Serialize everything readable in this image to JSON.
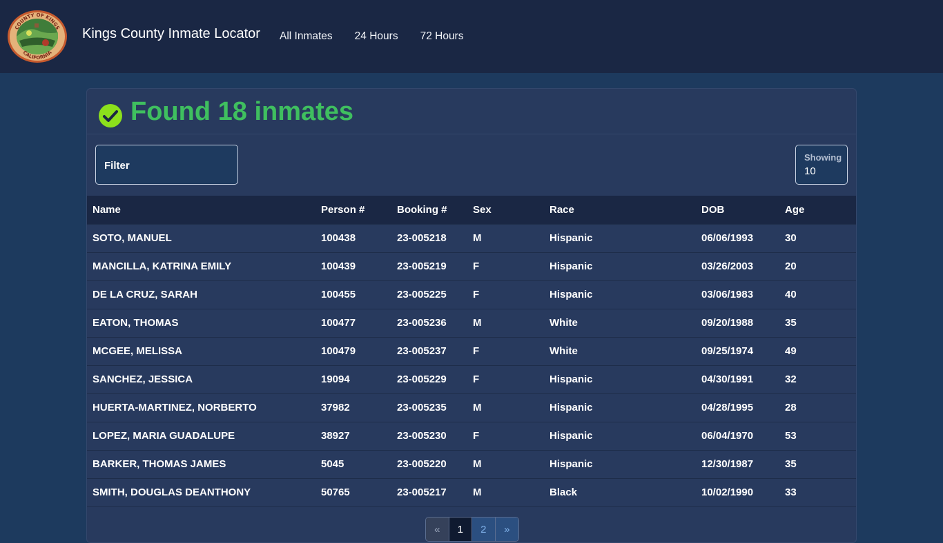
{
  "header": {
    "brand": "Kings County Inmate Locator",
    "nav": [
      "All Inmates",
      "24 Hours",
      "72 Hours"
    ],
    "logo_icon": "county-seal-logo",
    "logo_text_top": "COUNTY OF KINGS",
    "logo_text_bottom": "CALIFORNIA"
  },
  "results": {
    "title": "Found 18 inmates",
    "success_color": "#3fbf5f"
  },
  "filter": {
    "label": "Filter"
  },
  "showing": {
    "label": "Showing",
    "value": "10"
  },
  "table": {
    "columns": [
      "Name",
      "Person #",
      "Booking #",
      "Sex",
      "Race",
      "DOB",
      "Age"
    ],
    "rows": [
      [
        "SOTO, MANUEL",
        "100438",
        "23-005218",
        "M",
        "Hispanic",
        "06/06/1993",
        "30"
      ],
      [
        "MANCILLA, KATRINA EMILY",
        "100439",
        "23-005219",
        "F",
        "Hispanic",
        "03/26/2003",
        "20"
      ],
      [
        "DE LA CRUZ, SARAH",
        "100455",
        "23-005225",
        "F",
        "Hispanic",
        "03/06/1983",
        "40"
      ],
      [
        "EATON, THOMAS",
        "100477",
        "23-005236",
        "M",
        "White",
        "09/20/1988",
        "35"
      ],
      [
        "MCGEE, MELISSA",
        "100479",
        "23-005237",
        "F",
        "White",
        "09/25/1974",
        "49"
      ],
      [
        "SANCHEZ, JESSICA",
        "19094",
        "23-005229",
        "F",
        "Hispanic",
        "04/30/1991",
        "32"
      ],
      [
        "HUERTA-MARTINEZ, NORBERTO",
        "37982",
        "23-005235",
        "M",
        "Hispanic",
        "04/28/1995",
        "28"
      ],
      [
        "LOPEZ, MARIA GUADALUPE",
        "38927",
        "23-005230",
        "F",
        "Hispanic",
        "06/04/1970",
        "53"
      ],
      [
        "BARKER, THOMAS JAMES",
        "5045",
        "23-005220",
        "M",
        "Hispanic",
        "12/30/1987",
        "35"
      ],
      [
        "SMITH, DOUGLAS DEANTHONY",
        "50765",
        "23-005217",
        "M",
        "Black",
        "10/02/1990",
        "33"
      ]
    ]
  },
  "pagination": {
    "prev": "«",
    "pages": [
      "1",
      "2"
    ],
    "current": "1",
    "next": "»"
  }
}
